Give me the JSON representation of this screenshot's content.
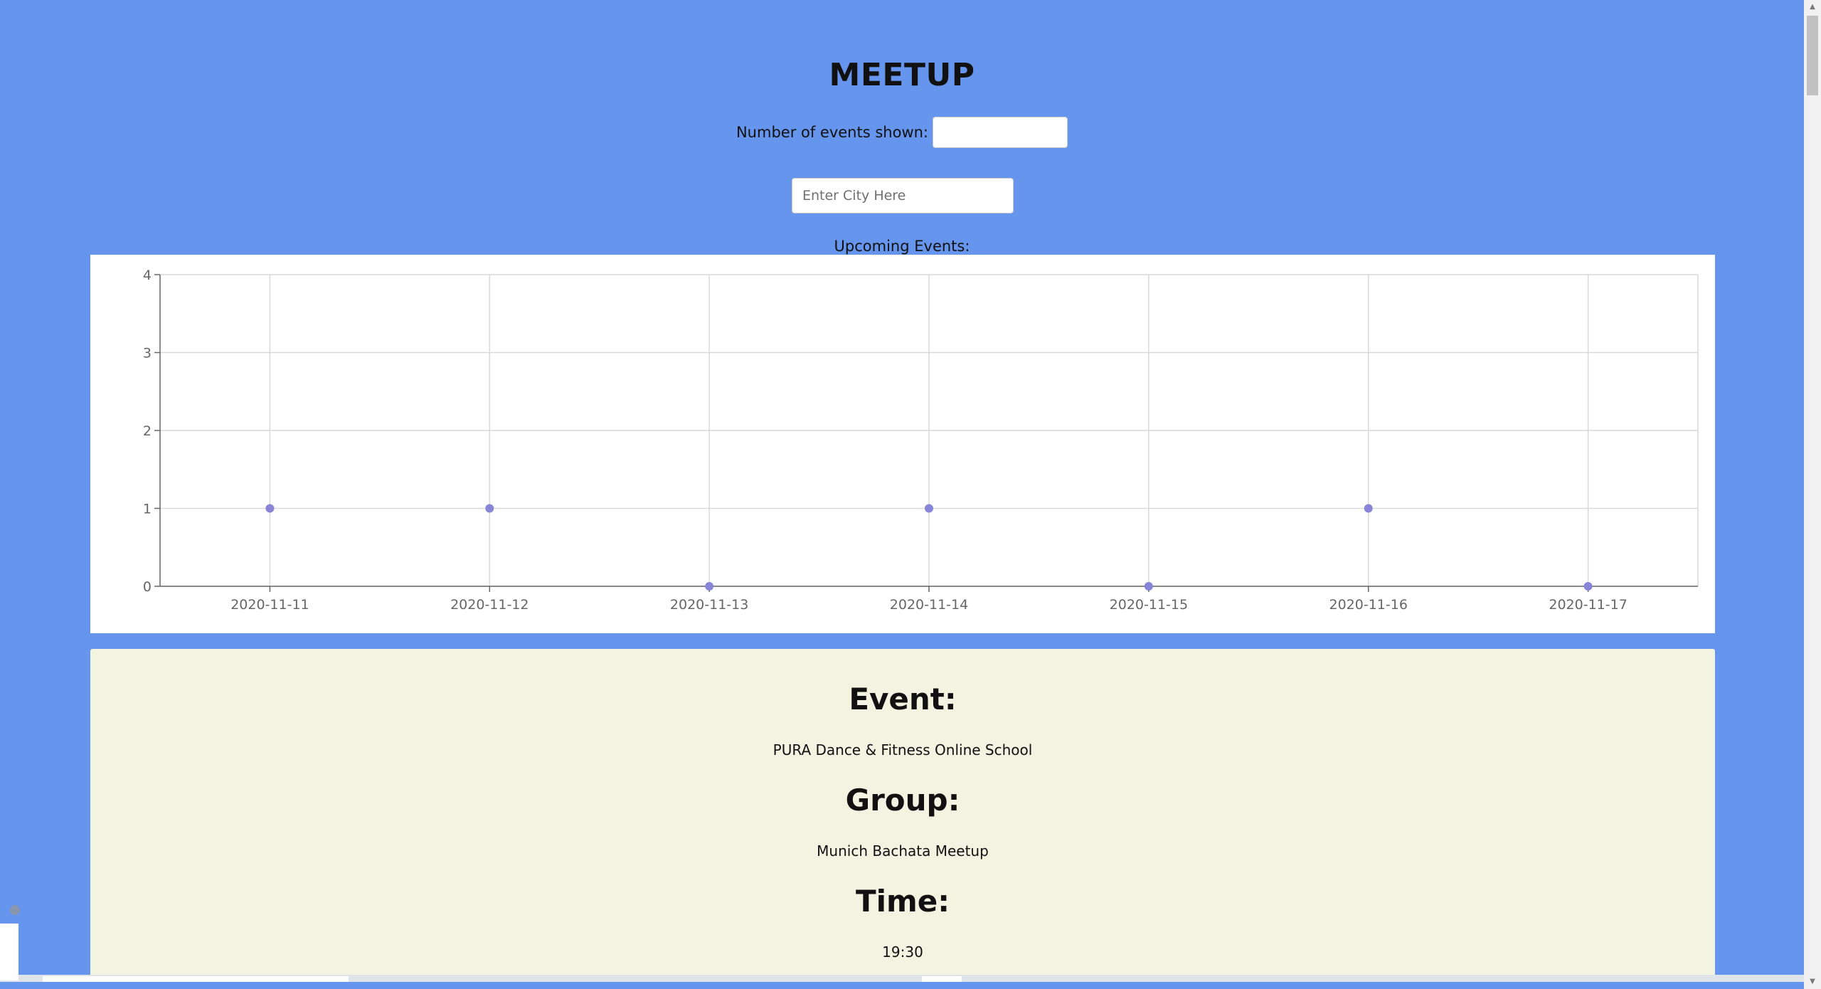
{
  "header": {
    "title": "MEETUP",
    "count_label": "Number of events shown:",
    "count_value": ""
  },
  "city_search": {
    "placeholder": "Enter City Here",
    "value": ""
  },
  "upcoming_label": "Upcoming Events:",
  "chart_data": {
    "type": "scatter",
    "x": [
      "2020-11-11",
      "2020-11-12",
      "2020-11-13",
      "2020-11-14",
      "2020-11-15",
      "2020-11-16",
      "2020-11-17"
    ],
    "y": [
      1,
      1,
      0,
      1,
      0,
      1,
      0
    ],
    "ylim": [
      0,
      4
    ],
    "yticks": [
      0,
      1,
      2,
      3,
      4
    ],
    "grid": true,
    "point_color": "#8884d8"
  },
  "event": {
    "event_heading": "Event:",
    "event_name": "PURA Dance & Fitness Online School",
    "group_heading": "Group:",
    "group_name": "Munich Bachata Meetup",
    "time_heading": "Time:",
    "time_value": "19:30"
  },
  "colors": {
    "background": "#6595ec",
    "card": "#f3f3e1",
    "chart_bg": "#ffffff"
  }
}
